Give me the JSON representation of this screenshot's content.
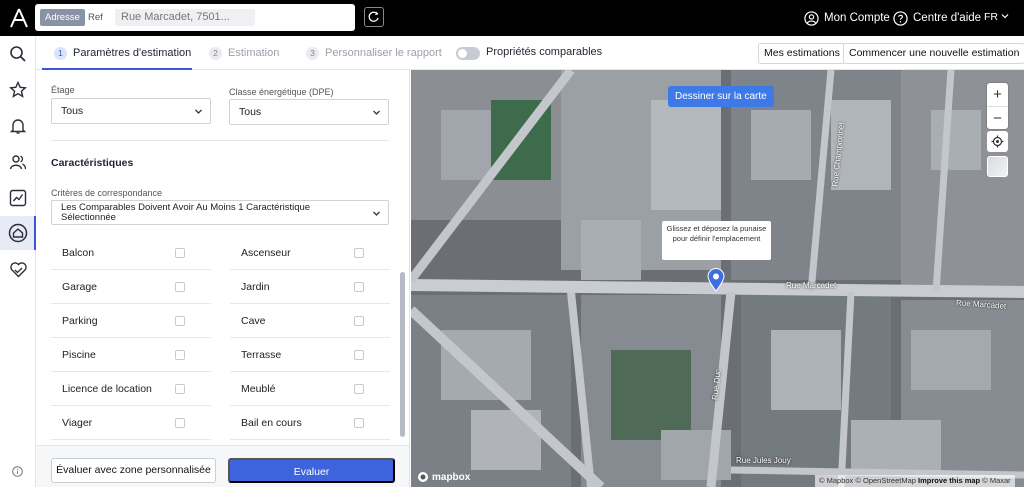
{
  "topbar": {
    "search_mode_address": "Adresse",
    "search_mode_ref": "Ref",
    "address_value": "Rue Marcadet, 7501...",
    "account_label": "Mon Compte",
    "help_label": "Centre d'aide",
    "language": "FR"
  },
  "tabs": [
    {
      "num": "1",
      "label": "Paramètres d'estimation"
    },
    {
      "num": "2",
      "label": "Estimation"
    },
    {
      "num": "3",
      "label": "Personnaliser le rapport"
    }
  ],
  "comparables_toggle": {
    "label": "Propriétés comparables",
    "on": false
  },
  "actions": {
    "my_estimations": "Mes estimations",
    "new_estimation": "Commencer une nouvelle estimation"
  },
  "form": {
    "floor": {
      "label": "Étage",
      "value": "Tous"
    },
    "energy_class": {
      "label": "Classe énergétique (DPE)",
      "value": "Tous"
    },
    "section_title": "Caractéristiques",
    "matching": {
      "label": "Critères de correspondance",
      "value_line1": "Les Comparables Doivent Avoir Au Moins 1 Caractéristique",
      "value_line2": "Sélectionnée"
    },
    "features": [
      {
        "label": "Balcon",
        "checked": false
      },
      {
        "label": "Ascenseur",
        "checked": false
      },
      {
        "label": "Garage",
        "checked": false
      },
      {
        "label": "Jardin",
        "checked": false
      },
      {
        "label": "Parking",
        "checked": false
      },
      {
        "label": "Cave",
        "checked": false
      },
      {
        "label": "Piscine",
        "checked": false
      },
      {
        "label": "Terrasse",
        "checked": false
      },
      {
        "label": "Licence de location",
        "checked": false
      },
      {
        "label": "Meublé",
        "checked": false
      },
      {
        "label": "Viager",
        "checked": false
      },
      {
        "label": "Bail en cours",
        "checked": false
      }
    ],
    "btn_custom_zone": "Évaluer avec zone personnalisée",
    "btn_evaluate": "Evaluer"
  },
  "map": {
    "draw_button": "Dessiner sur la carte",
    "tooltip": "Glissez et déposez la punaise pour définir l'emplacement",
    "streets": [
      "Rue Marcadet",
      "Rue Marcadet",
      "Rue Jules Jouy",
      "Rue Duc",
      "Rue Championnet"
    ],
    "mapbox": "mapbox",
    "attribution_prefix": "© Mapbox © OpenStreetMap",
    "attribution_link": "Improve this map",
    "attribution_suffix": "© Maxar"
  },
  "colors": {
    "accent": "#3d63dd",
    "topbar": "#000000",
    "map_button": "#3d7ae8"
  }
}
